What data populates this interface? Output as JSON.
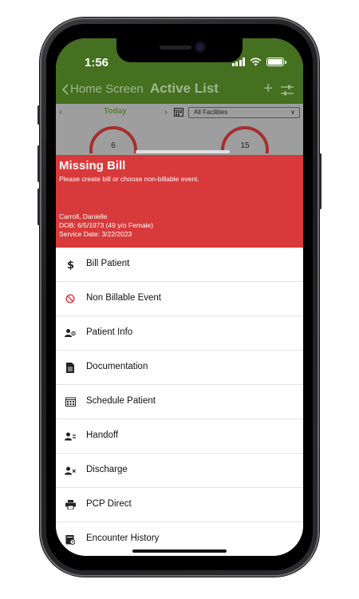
{
  "status_bar": {
    "time": "1:56"
  },
  "nav": {
    "back_label": "Home Screen",
    "title": "Active List",
    "add_symbol": "+"
  },
  "filters": {
    "date_label": "Today",
    "facility_selected": "All Facilities"
  },
  "gauges": [
    {
      "value": "6"
    },
    {
      "value": "15"
    }
  ],
  "alert": {
    "title": "Missing Bill",
    "message": "Please create bill or choose non-billable event.",
    "patient_name": "Carroll, Danielle",
    "dob": "DOB: 6/5/1973 (49 y/o Female)",
    "service_date": "Service Date: 3/22/2023",
    "color": "#d8393a"
  },
  "actions": [
    {
      "label": "Bill Patient",
      "icon": "dollar-icon"
    },
    {
      "label": "Non Billable Event",
      "icon": "prohibited-icon"
    },
    {
      "label": "Patient Info",
      "icon": "patient-info-icon"
    },
    {
      "label": "Documentation",
      "icon": "document-icon"
    },
    {
      "label": "Schedule Patient",
      "icon": "calendar-icon"
    },
    {
      "label": "Handoff",
      "icon": "handoff-icon"
    },
    {
      "label": "Discharge",
      "icon": "discharge-icon"
    },
    {
      "label": "PCP Direct",
      "icon": "printer-icon"
    },
    {
      "label": "Encounter History",
      "icon": "history-icon"
    }
  ],
  "colors": {
    "header": "#45701f",
    "alert": "#d8393a",
    "prohibited": "#d8393a"
  }
}
